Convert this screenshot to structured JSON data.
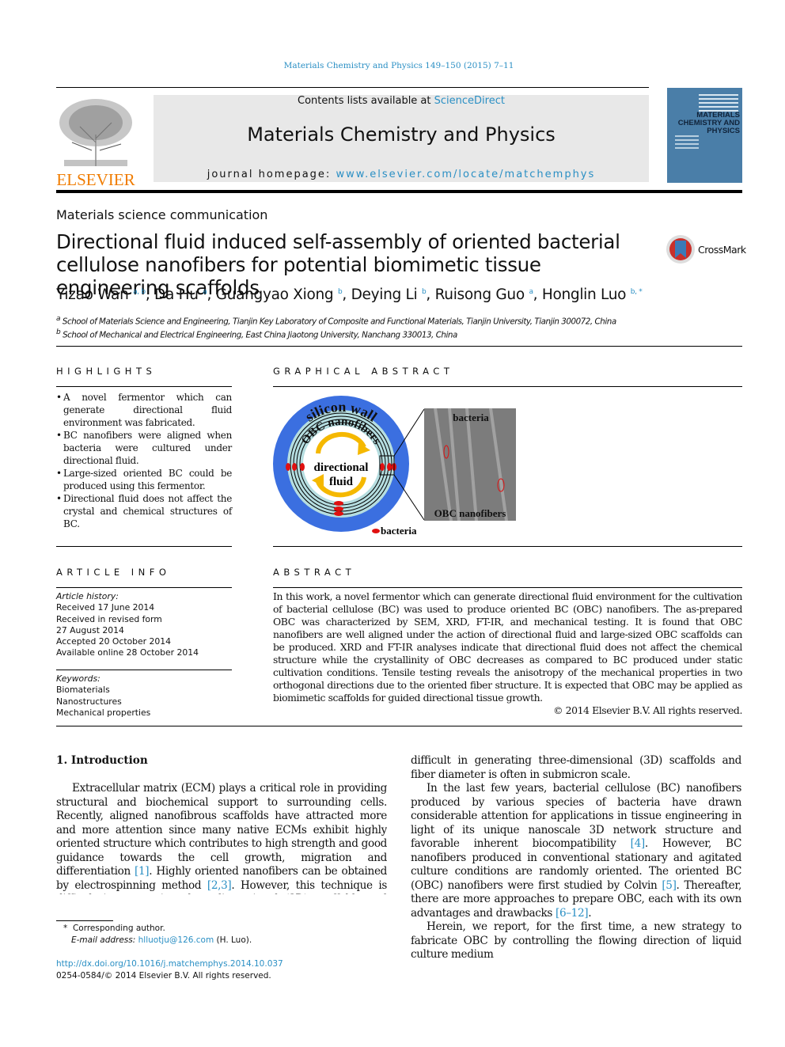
{
  "journal_ref": "Materials Chemistry and Physics 149–150 (2015) 7–11",
  "header": {
    "contents_prefix": "Contents lists available at ",
    "contents_link": "ScienceDirect",
    "journal_title": "Materials Chemistry and Physics",
    "homepage_prefix": "journal homepage: ",
    "homepage_link": "www.elsevier.com/locate/matchemphys",
    "publisher": "ELSEVIER",
    "cover_title": "MATERIALS CHEMISTRY AND PHYSICS"
  },
  "article_type": "Materials science communication",
  "title": "Directional fluid induced self-assembly of oriented bacterial cellulose nanofibers for potential biomimetic tissue engineering scaffolds",
  "crossmark": "CrossMark",
  "authors": [
    {
      "name": "Yizao Wan",
      "sup": "a, b"
    },
    {
      "name": "Da Hu",
      "sup": "a"
    },
    {
      "name": "Guangyao Xiong",
      "sup": "b"
    },
    {
      "name": "Deying Li",
      "sup": "b"
    },
    {
      "name": "Ruisong Guo",
      "sup": "a"
    },
    {
      "name": "Honglin Luo",
      "sup": "b, *"
    }
  ],
  "affiliations": [
    {
      "mark": "a",
      "text": "School of Materials Science and Engineering, Tianjin Key Laboratory of Composite and Functional Materials, Tianjin University, Tianjin 300072, China"
    },
    {
      "mark": "b",
      "text": "School of Mechanical and Electrical Engineering, East China Jiaotong University, Nanchang 330013, China"
    }
  ],
  "highlights": {
    "heading": "HIGHLIGHTS",
    "items": [
      "A novel fermentor which can generate directional fluid environment was fabricated.",
      "BC nanofibers were aligned when bacteria were cultured under directional fluid.",
      "Large-sized oriented BC could be produced using this fermentor.",
      "Directional fluid does not affect the crystal and chemical structures of BC."
    ]
  },
  "graphical_abstract": {
    "heading": "GRAPHICAL ABSTRACT",
    "labels": {
      "wall": "silicon wall",
      "fibers": "OBC nanofibers",
      "fluid1": "directional",
      "fluid2": "fluid",
      "sem_bacteria": "bacteria",
      "sem_fibers": "OBC nanofibers",
      "legend": "bacteria"
    },
    "colors": {
      "wall": "#3b6fe0",
      "fibers": "#b5dde0",
      "arrows": "#f5b800",
      "bacteria": "#e01010"
    }
  },
  "article_info": {
    "heading": "ARTICLE INFO",
    "history_label": "Article history:",
    "history": [
      "Received 17 June 2014",
      "Received in revised form",
      "27 August 2014",
      "Accepted 20 October 2014",
      "Available online 28 October 2014"
    ],
    "keywords_label": "Keywords:",
    "keywords": [
      "Biomaterials",
      "Nanostructures",
      "Mechanical properties"
    ]
  },
  "abstract": {
    "heading": "ABSTRACT",
    "text": "In this work, a novel fermentor which can generate directional fluid environment for the cultivation of bacterial cellulose (BC) was used to produce oriented BC (OBC) nanofibers. The as-prepared OBC was characterized by SEM, XRD, FT-IR, and mechanical testing. It is found that OBC nanofibers are well aligned under the action of directional fluid and large-sized OBC scaffolds can be produced. XRD and FT-IR analyses indicate that directional fluid does not affect the chemical structure while the crystallinity of OBC decreases as compared to BC produced under static cultivation conditions. Tensile testing reveals the anisotropy of the mechanical properties in two orthogonal directions due to the oriented fiber structure. It is expected that OBC may be applied as biomimetic scaffolds for guided directional tissue growth.",
    "copyright": "© 2014 Elsevier B.V. All rights reserved."
  },
  "intro": {
    "heading": "1.  Introduction",
    "p1": {
      "a": "Extracellular matrix (ECM) plays a critical role in providing structural and biochemical support to surrounding cells. Recently, aligned nanofibrous scaffolds have attracted more and more attention since many native ECMs exhibit highly oriented structure which contributes to high strength and good guidance towards the cell growth, migration and differentiation ",
      "r1": "[1]",
      "b": ". Highly oriented nanofibers can be obtained by electrospinning method ",
      "r2": "[2,3]",
      "c": ". However, this technique is difficult in generating three-dimensional (3D) scaffolds and fiber diameter is often in submicron scale."
    },
    "p2": {
      "a": "In the last few years, bacterial cellulose (BC) nanofibers produced by various species of bacteria have drawn considerable attention for applications in tissue engineering in light of its unique nanoscale 3D network structure and favorable inherent biocompatibility ",
      "r1": "[4]",
      "b": ". However, BC nanofibers produced in conventional stationary and agitated culture conditions are randomly oriented. The oriented BC (OBC) nanofibers were first studied by Colvin ",
      "r2": "[5]",
      "c": ". Thereafter, there are more approaches to prepare OBC, each with its own advantages and drawbacks ",
      "r3": "[6–12]",
      "d": "."
    },
    "p3": "Herein, we report, for the first time, a new strategy to fabricate OBC by controlling the flowing direction of liquid culture medium"
  },
  "footnote": {
    "star": "*",
    "corresponding": "Corresponding author.",
    "email_label": "E-mail address: ",
    "email": "hlluotju@126.com",
    "email_suffix": " (H. Luo).",
    "doi": "http://dx.doi.org/10.1016/j.matchemphys.2014.10.037",
    "issn": "0254-0584/© 2014 Elsevier B.V. All rights reserved."
  }
}
